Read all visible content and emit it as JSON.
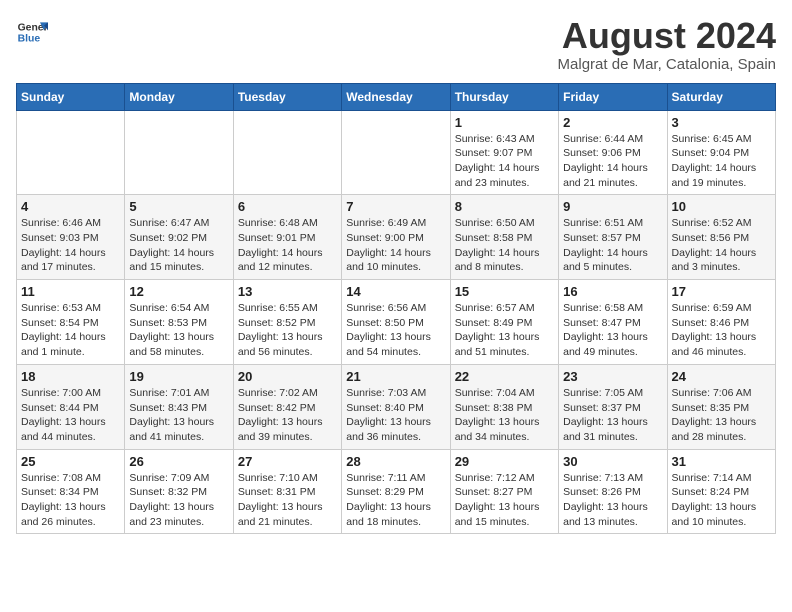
{
  "logo": {
    "general": "General",
    "blue": "Blue"
  },
  "header": {
    "title": "August 2024",
    "subtitle": "Malgrat de Mar, Catalonia, Spain"
  },
  "days_of_week": [
    "Sunday",
    "Monday",
    "Tuesday",
    "Wednesday",
    "Thursday",
    "Friday",
    "Saturday"
  ],
  "weeks": [
    [
      {
        "day": "",
        "info": ""
      },
      {
        "day": "",
        "info": ""
      },
      {
        "day": "",
        "info": ""
      },
      {
        "day": "",
        "info": ""
      },
      {
        "day": "1",
        "info": "Sunrise: 6:43 AM\nSunset: 9:07 PM\nDaylight: 14 hours and 23 minutes."
      },
      {
        "day": "2",
        "info": "Sunrise: 6:44 AM\nSunset: 9:06 PM\nDaylight: 14 hours and 21 minutes."
      },
      {
        "day": "3",
        "info": "Sunrise: 6:45 AM\nSunset: 9:04 PM\nDaylight: 14 hours and 19 minutes."
      }
    ],
    [
      {
        "day": "4",
        "info": "Sunrise: 6:46 AM\nSunset: 9:03 PM\nDaylight: 14 hours and 17 minutes."
      },
      {
        "day": "5",
        "info": "Sunrise: 6:47 AM\nSunset: 9:02 PM\nDaylight: 14 hours and 15 minutes."
      },
      {
        "day": "6",
        "info": "Sunrise: 6:48 AM\nSunset: 9:01 PM\nDaylight: 14 hours and 12 minutes."
      },
      {
        "day": "7",
        "info": "Sunrise: 6:49 AM\nSunset: 9:00 PM\nDaylight: 14 hours and 10 minutes."
      },
      {
        "day": "8",
        "info": "Sunrise: 6:50 AM\nSunset: 8:58 PM\nDaylight: 14 hours and 8 minutes."
      },
      {
        "day": "9",
        "info": "Sunrise: 6:51 AM\nSunset: 8:57 PM\nDaylight: 14 hours and 5 minutes."
      },
      {
        "day": "10",
        "info": "Sunrise: 6:52 AM\nSunset: 8:56 PM\nDaylight: 14 hours and 3 minutes."
      }
    ],
    [
      {
        "day": "11",
        "info": "Sunrise: 6:53 AM\nSunset: 8:54 PM\nDaylight: 14 hours and 1 minute."
      },
      {
        "day": "12",
        "info": "Sunrise: 6:54 AM\nSunset: 8:53 PM\nDaylight: 13 hours and 58 minutes."
      },
      {
        "day": "13",
        "info": "Sunrise: 6:55 AM\nSunset: 8:52 PM\nDaylight: 13 hours and 56 minutes."
      },
      {
        "day": "14",
        "info": "Sunrise: 6:56 AM\nSunset: 8:50 PM\nDaylight: 13 hours and 54 minutes."
      },
      {
        "day": "15",
        "info": "Sunrise: 6:57 AM\nSunset: 8:49 PM\nDaylight: 13 hours and 51 minutes."
      },
      {
        "day": "16",
        "info": "Sunrise: 6:58 AM\nSunset: 8:47 PM\nDaylight: 13 hours and 49 minutes."
      },
      {
        "day": "17",
        "info": "Sunrise: 6:59 AM\nSunset: 8:46 PM\nDaylight: 13 hours and 46 minutes."
      }
    ],
    [
      {
        "day": "18",
        "info": "Sunrise: 7:00 AM\nSunset: 8:44 PM\nDaylight: 13 hours and 44 minutes."
      },
      {
        "day": "19",
        "info": "Sunrise: 7:01 AM\nSunset: 8:43 PM\nDaylight: 13 hours and 41 minutes."
      },
      {
        "day": "20",
        "info": "Sunrise: 7:02 AM\nSunset: 8:42 PM\nDaylight: 13 hours and 39 minutes."
      },
      {
        "day": "21",
        "info": "Sunrise: 7:03 AM\nSunset: 8:40 PM\nDaylight: 13 hours and 36 minutes."
      },
      {
        "day": "22",
        "info": "Sunrise: 7:04 AM\nSunset: 8:38 PM\nDaylight: 13 hours and 34 minutes."
      },
      {
        "day": "23",
        "info": "Sunrise: 7:05 AM\nSunset: 8:37 PM\nDaylight: 13 hours and 31 minutes."
      },
      {
        "day": "24",
        "info": "Sunrise: 7:06 AM\nSunset: 8:35 PM\nDaylight: 13 hours and 28 minutes."
      }
    ],
    [
      {
        "day": "25",
        "info": "Sunrise: 7:08 AM\nSunset: 8:34 PM\nDaylight: 13 hours and 26 minutes."
      },
      {
        "day": "26",
        "info": "Sunrise: 7:09 AM\nSunset: 8:32 PM\nDaylight: 13 hours and 23 minutes."
      },
      {
        "day": "27",
        "info": "Sunrise: 7:10 AM\nSunset: 8:31 PM\nDaylight: 13 hours and 21 minutes."
      },
      {
        "day": "28",
        "info": "Sunrise: 7:11 AM\nSunset: 8:29 PM\nDaylight: 13 hours and 18 minutes."
      },
      {
        "day": "29",
        "info": "Sunrise: 7:12 AM\nSunset: 8:27 PM\nDaylight: 13 hours and 15 minutes."
      },
      {
        "day": "30",
        "info": "Sunrise: 7:13 AM\nSunset: 8:26 PM\nDaylight: 13 hours and 13 minutes."
      },
      {
        "day": "31",
        "info": "Sunrise: 7:14 AM\nSunset: 8:24 PM\nDaylight: 13 hours and 10 minutes."
      }
    ]
  ]
}
